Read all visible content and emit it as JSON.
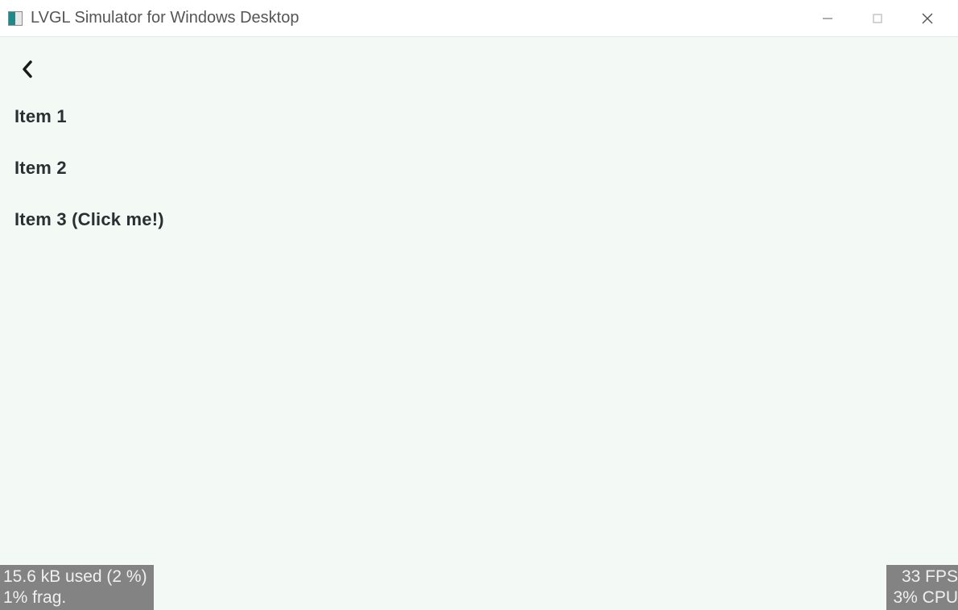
{
  "window": {
    "title": "LVGL Simulator for Windows Desktop"
  },
  "menu": {
    "items": [
      {
        "label": "Item 1"
      },
      {
        "label": "Item 2"
      },
      {
        "label": "Item 3 (Click me!)"
      }
    ]
  },
  "status": {
    "left_line1": "15.6 kB used (2 %)",
    "left_line2": "1% frag.",
    "right_line1": "33 FPS",
    "right_line2": "3% CPU"
  }
}
